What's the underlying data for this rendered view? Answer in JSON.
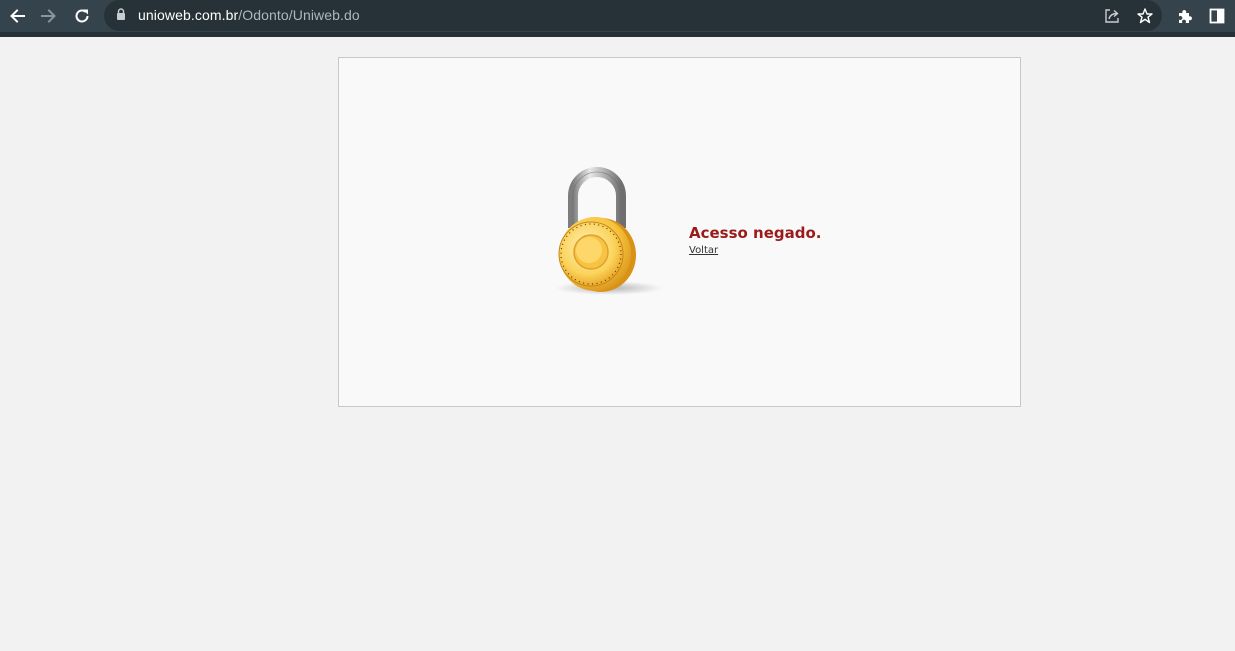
{
  "browser": {
    "url_domain": "unioweb.com.br",
    "url_path": "/Odonto/Uniweb.do",
    "icons": [
      "back-arrow-icon",
      "forward-arrow-icon",
      "reload-icon",
      "lock-icon",
      "share-icon",
      "star-icon",
      "extensions-puzzle-icon",
      "side-panel-icon"
    ]
  },
  "page": {
    "message": "Acesso negado.",
    "back_link": "Voltar",
    "icon": "padlock-icon",
    "colors": {
      "message": "#9b1a1a",
      "background": "#f2f2f2",
      "panel": "#f9f9f9",
      "toolbar": "#35434c"
    }
  }
}
